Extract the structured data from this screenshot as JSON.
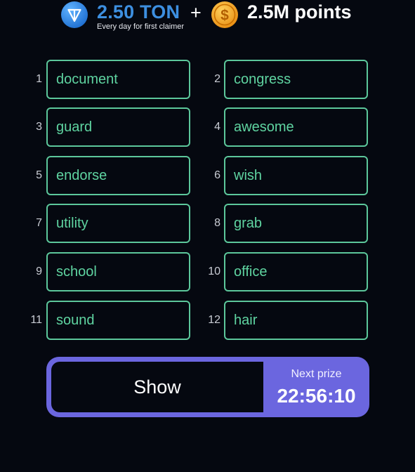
{
  "header": {
    "ton_amount": "2.50 TON",
    "ton_subtitle": "Every day for first claimer",
    "plus": "+",
    "points": "2.5M points",
    "ton_icon": "ton-diamond-icon",
    "coin_icon": "dollar-coin-icon"
  },
  "words": [
    {
      "number": "1",
      "word": "document"
    },
    {
      "number": "2",
      "word": "congress"
    },
    {
      "number": "3",
      "word": "guard"
    },
    {
      "number": "4",
      "word": "awesome"
    },
    {
      "number": "5",
      "word": "endorse"
    },
    {
      "number": "6",
      "word": "wish"
    },
    {
      "number": "7",
      "word": "utility"
    },
    {
      "number": "8",
      "word": "grab"
    },
    {
      "number": "9",
      "word": "school"
    },
    {
      "number": "10",
      "word": "office"
    },
    {
      "number": "11",
      "word": "sound"
    },
    {
      "number": "12",
      "word": "hair"
    }
  ],
  "action": {
    "show_label": "Show",
    "next_prize_label": "Next prize",
    "timer": "22:56:10"
  },
  "colors": {
    "background": "#050810",
    "word_border": "#5cc79b",
    "word_text": "#5fd4a1",
    "ton_blue": "#3d8fe0",
    "accent_purple": "#6b66df",
    "coin_gold": "#f2a21b"
  }
}
